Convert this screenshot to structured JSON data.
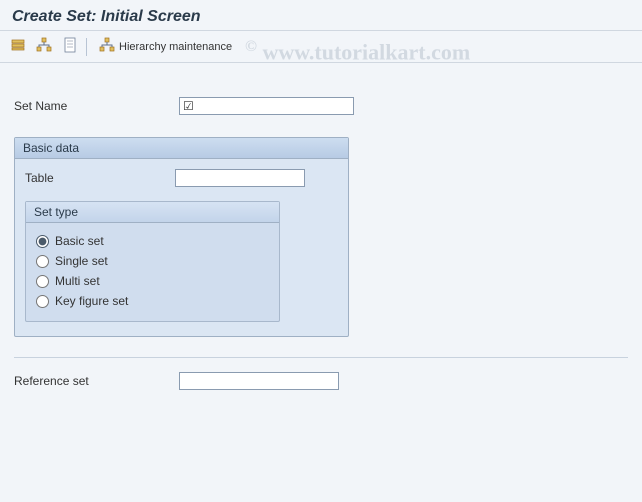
{
  "header": {
    "title": "Create Set: Initial Screen"
  },
  "toolbar": {
    "hierarchy_label": "Hierarchy maintenance"
  },
  "fields": {
    "set_name_label": "Set Name",
    "set_name_value": "",
    "table_label": "Table",
    "table_value": "",
    "reference_label": "Reference set",
    "reference_value": ""
  },
  "groupbox": {
    "basic_data_title": "Basic data",
    "set_type_title": "Set type"
  },
  "radios": {
    "basic": "Basic set",
    "single": "Single set",
    "multi": "Multi set",
    "keyfig": "Key figure set",
    "selected": "basic"
  },
  "watermark": "www.tutorialkart.com",
  "icons": {
    "values": "values-icon",
    "hierarchy": "hierarchy-icon",
    "document": "document-icon",
    "hierarchy_maint": "hierarchy-maint-icon"
  }
}
